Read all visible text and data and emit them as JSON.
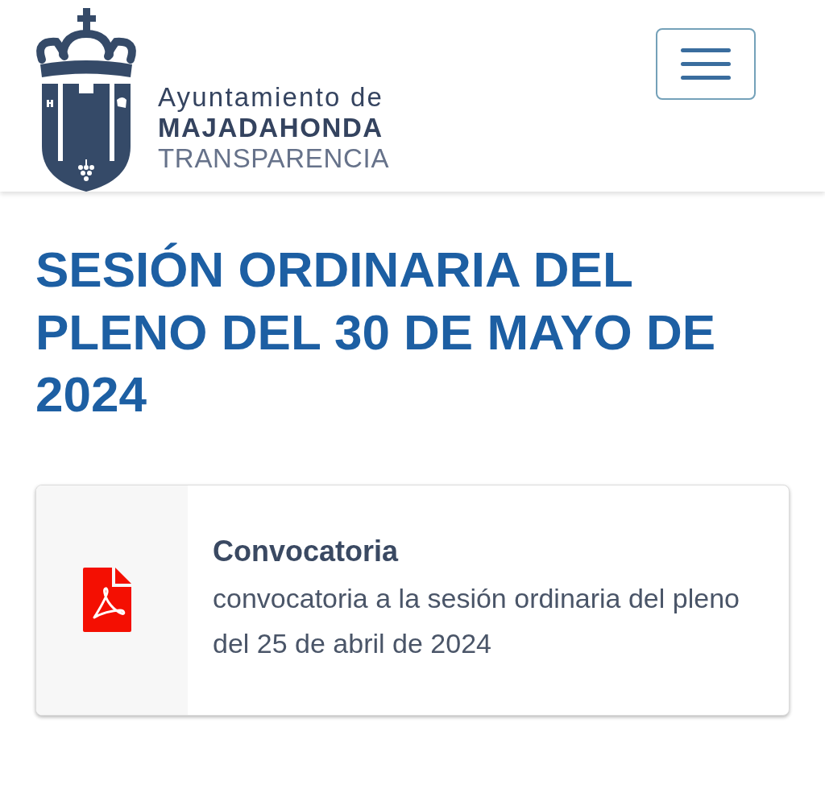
{
  "header": {
    "logo": {
      "lines": [
        "Ayuntamiento de",
        "MAJADAHONDA",
        "TRANSPARENCIA"
      ]
    }
  },
  "page": {
    "title": "SESIÓN ORDINARIA DEL PLENO DEL 30 DE MAYO DE 2024"
  },
  "documents": [
    {
      "kind": "pdf",
      "title": "Convocatoria",
      "description": "convocatoria a la sesión ordinaria del pleno del 25 de abril de 2024"
    }
  ]
}
